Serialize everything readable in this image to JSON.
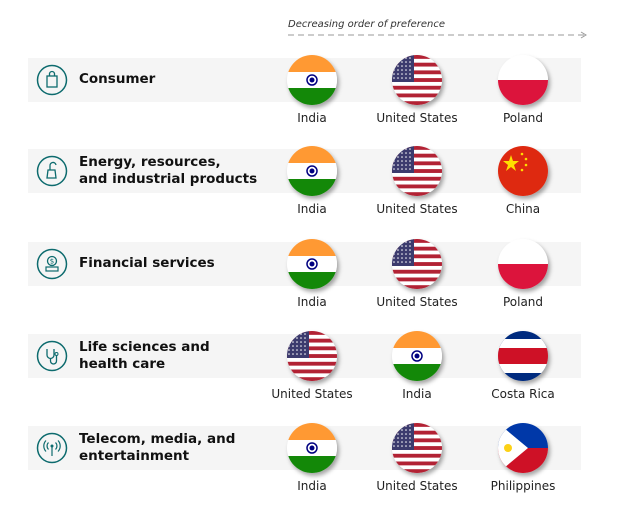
{
  "header": {
    "label": "Decreasing order of preference"
  },
  "colors": {
    "accent": "#0d6b6e",
    "band": "#f5f5f5"
  },
  "sectors": [
    {
      "name": "Consumer",
      "icon": "shopping-bag-icon",
      "countries": [
        "India",
        "United States",
        "Poland"
      ]
    },
    {
      "name": "Energy, resources,\nand industrial products",
      "icon": "factory-icon",
      "countries": [
        "India",
        "United States",
        "China"
      ]
    },
    {
      "name": "Financial services",
      "icon": "money-icon",
      "countries": [
        "India",
        "United States",
        "Poland"
      ]
    },
    {
      "name": "Life sciences and\nhealth care",
      "icon": "stethoscope-icon",
      "countries": [
        "United States",
        "India",
        "Costa Rica"
      ]
    },
    {
      "name": "Telecom, media, and\nentertainment",
      "icon": "antenna-icon",
      "countries": [
        "India",
        "United States",
        "Philippines"
      ]
    }
  ]
}
